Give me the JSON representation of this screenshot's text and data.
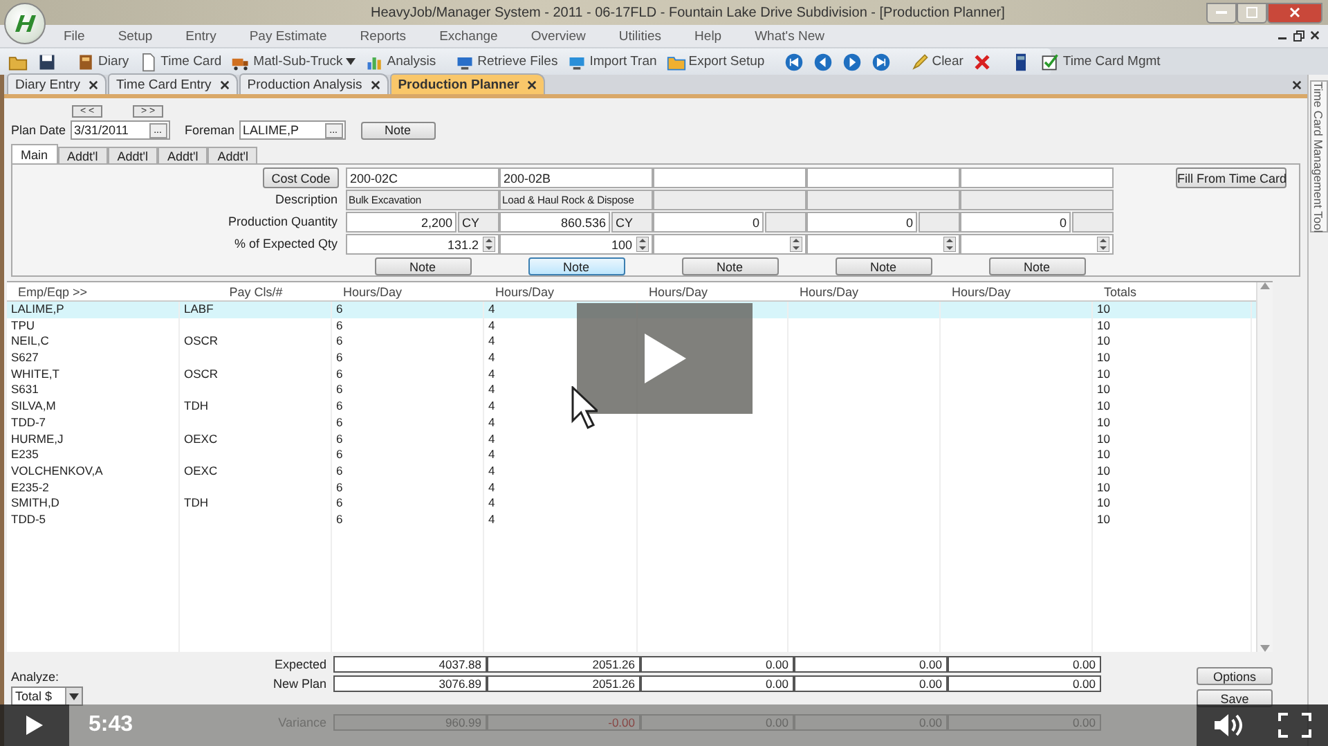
{
  "window": {
    "title": "HeavyJob/Manager System - 2011 - 06-17FLD - Fountain Lake Drive Subdivision - [Production Planner]"
  },
  "menu": [
    "File",
    "Setup",
    "Entry",
    "Pay Estimate",
    "Reports",
    "Exchange",
    "Overview",
    "Utilities",
    "Help",
    "What's New"
  ],
  "toolbar": [
    {
      "kind": "icon"
    },
    {
      "kind": "icon"
    },
    {
      "kind": "separator"
    },
    {
      "kind": "button",
      "label": "Diary"
    },
    {
      "kind": "button",
      "label": "Time Card"
    },
    {
      "kind": "dropdown",
      "label": "Matl-Sub-Truck"
    },
    {
      "kind": "button",
      "label": "Analysis"
    },
    {
      "kind": "separator"
    },
    {
      "kind": "button",
      "label": "Retrieve Files"
    },
    {
      "kind": "button",
      "label": "Import Tran"
    },
    {
      "kind": "button",
      "label": "Export Setup"
    },
    {
      "kind": "separator"
    },
    {
      "kind": "icon"
    },
    {
      "kind": "icon"
    },
    {
      "kind": "icon"
    },
    {
      "kind": "icon"
    },
    {
      "kind": "separator"
    },
    {
      "kind": "button",
      "label": "Clear"
    },
    {
      "kind": "icon"
    },
    {
      "kind": "separator"
    },
    {
      "kind": "icon"
    },
    {
      "kind": "button",
      "label": "Time Card Mgmt"
    }
  ],
  "doc_tabs": [
    {
      "label": "Diary Entry",
      "selected": false
    },
    {
      "label": "Time Card Entry",
      "selected": false
    },
    {
      "label": "Production Analysis",
      "selected": false
    },
    {
      "label": "Production Planner",
      "selected": true
    }
  ],
  "side_panel": {
    "label": "Time Card Management Tool"
  },
  "form": {
    "prev_button": "< <",
    "next_button": "> >",
    "plan_date_label": "Plan Date",
    "plan_date": "3/31/2011",
    "plan_date_browse": "...",
    "foreman_label": "Foreman",
    "foreman": "LALIME,P",
    "foreman_browse": "...",
    "note_button": "Note"
  },
  "sub_tabs": [
    {
      "label": "Main",
      "selected": true
    },
    {
      "label": "Addt'l",
      "selected": false
    },
    {
      "label": "Addt'l",
      "selected": false
    },
    {
      "label": "Addt'l",
      "selected": false
    },
    {
      "label": "Addt'l",
      "selected": false
    }
  ],
  "cost_grid": {
    "cost_code_button": "Cost Code",
    "description_label": "Description",
    "quantity_label": "Production Quantity",
    "percent_label": "% of Expected Qty",
    "fill_button": "Fill From Time Card",
    "columns": [
      {
        "code": "200-02C",
        "description": "Bulk Excavation",
        "quantity": "2,200",
        "unit": "CY",
        "percent": "131.2",
        "note": "Note",
        "focused": false
      },
      {
        "code": "200-02B",
        "description": "Load & Haul Rock & Dispose",
        "quantity": "860.536",
        "unit": "CY",
        "percent": "100",
        "note": "Note",
        "focused": true
      },
      {
        "quantity": "0",
        "note": "Note",
        "focused": false
      },
      {
        "quantity": "0",
        "note": "Note",
        "focused": false
      },
      {
        "quantity": "0",
        "note": "Note",
        "focused": false
      }
    ]
  },
  "table": {
    "columns": [
      "Emp/Eqp >>",
      "Pay Cls/#",
      "Hours/Day",
      "Hours/Day",
      "Hours/Day",
      "Hours/Day",
      "Hours/Day",
      "Totals"
    ],
    "rows": [
      {
        "emp": "LALIME,P",
        "pay_class": "LABF",
        "hours": [
          "6",
          "4"
        ],
        "total": "10",
        "selected": true
      },
      {
        "emp": "TPU",
        "hours": [
          "6",
          "4"
        ],
        "total": "10",
        "selected": false
      },
      {
        "emp": "NEIL,C",
        "pay_class": "OSCR",
        "hours": [
          "6",
          "4"
        ],
        "total": "10",
        "selected": false
      },
      {
        "emp": "S627",
        "hours": [
          "6",
          "4"
        ],
        "total": "10",
        "selected": false
      },
      {
        "emp": "WHITE,T",
        "pay_class": "OSCR",
        "hours": [
          "6",
          "4"
        ],
        "total": "10",
        "selected": false
      },
      {
        "emp": "S631",
        "hours": [
          "6",
          "4"
        ],
        "total": "10",
        "selected": false
      },
      {
        "emp": "SILVA,M",
        "pay_class": "TDH",
        "hours": [
          "6",
          "4"
        ],
        "total": "10",
        "selected": false
      },
      {
        "emp": "TDD-7",
        "hours": [
          "6",
          "4"
        ],
        "total": "10",
        "selected": false
      },
      {
        "emp": "HURME,J",
        "pay_class": "OEXC",
        "hours": [
          "6",
          "4"
        ],
        "total": "10",
        "selected": false
      },
      {
        "emp": "E235",
        "hours": [
          "6",
          "4"
        ],
        "total": "10",
        "selected": false
      },
      {
        "emp": "VOLCHENKOV,A",
        "pay_class": "OEXC",
        "hours": [
          "6",
          "4"
        ],
        "total": "10",
        "selected": false
      },
      {
        "emp": "E235-2",
        "hours": [
          "6",
          "4"
        ],
        "total": "10",
        "selected": false
      },
      {
        "emp": "SMITH,D",
        "pay_class": "TDH",
        "hours": [
          "6",
          "4"
        ],
        "total": "10",
        "selected": false
      },
      {
        "emp": "TDD-5",
        "hours": [
          "6",
          "4"
        ],
        "total": "10",
        "selected": false
      }
    ]
  },
  "summary": {
    "analyze_label": "Analyze:",
    "analyze_value": "Total $",
    "rows": [
      {
        "label": "Expected",
        "disabled": false,
        "values": [
          {
            "text": "4037.88",
            "negative": false
          },
          {
            "text": "2051.26",
            "negative": false
          },
          {
            "text": "0.00",
            "negative": false
          },
          {
            "text": "0.00",
            "negative": false
          },
          {
            "text": "0.00",
            "negative": false
          }
        ]
      },
      {
        "label": "New Plan",
        "disabled": false,
        "values": [
          {
            "text": "3076.89",
            "negative": false
          },
          {
            "text": "2051.26",
            "negative": false
          },
          {
            "text": "0.00",
            "negative": false
          },
          {
            "text": "0.00",
            "negative": false
          },
          {
            "text": "0.00",
            "negative": false
          }
        ]
      },
      {
        "label": "Variance",
        "disabled": true,
        "values": [
          {
            "text": "960.99",
            "negative": false
          },
          {
            "text": "-0.00",
            "negative": true
          },
          {
            "text": "0.00",
            "negative": false
          },
          {
            "text": "0.00",
            "negative": false
          },
          {
            "text": "0.00",
            "negative": false
          }
        ]
      }
    ],
    "buttons": [
      "Options",
      "Save"
    ]
  },
  "video_player": {
    "time": "5:43"
  }
}
